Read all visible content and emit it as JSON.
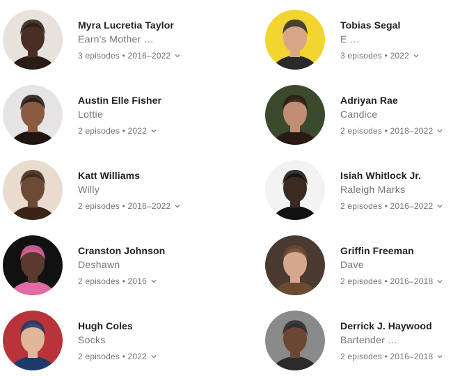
{
  "cast": [
    {
      "name": "Myra Lucretia Taylor",
      "role": "Earn's Mother …",
      "meta": "3 episodes • 2016–2022",
      "avatar_bg": "#e8e2dc",
      "avatar_fg": "#4a2d24",
      "avatar_accent": "#2b1b16"
    },
    {
      "name": "Tobias Segal",
      "role": "E …",
      "meta": "3 episodes • 2022",
      "avatar_bg": "#f2d530",
      "avatar_fg": "#d9a58a",
      "avatar_accent": "#2a2a2a"
    },
    {
      "name": "Austin Elle Fisher",
      "role": "Lottie",
      "meta": "2 episodes • 2022",
      "avatar_bg": "#e6e4e4",
      "avatar_fg": "#8a5a42",
      "avatar_accent": "#1f1511"
    },
    {
      "name": "Adriyan Rae",
      "role": "Candice",
      "meta": "2 episodes • 2018–2022",
      "avatar_bg": "#3b4a2c",
      "avatar_fg": "#c08e75",
      "avatar_accent": "#2a1a14"
    },
    {
      "name": "Katt Williams",
      "role": "Willy",
      "meta": "2 episodes • 2018–2022",
      "avatar_bg": "#e9dccf",
      "avatar_fg": "#6b4a36",
      "avatar_accent": "#3a2418"
    },
    {
      "name": "Isiah Whitlock Jr.",
      "role": "Raleigh Marks",
      "meta": "2 episodes • 2016–2022",
      "avatar_bg": "#f3f3f3",
      "avatar_fg": "#3a2a22",
      "avatar_accent": "#111111"
    },
    {
      "name": "Cranston Johnson",
      "role": "Deshawn",
      "meta": "2 episodes • 2016",
      "avatar_bg": "#111111",
      "avatar_fg": "#5a3a2c",
      "avatar_accent": "#e26aa6"
    },
    {
      "name": "Griffin Freeman",
      "role": "Dave",
      "meta": "2 episodes • 2016–2018",
      "avatar_bg": "#4a3a30",
      "avatar_fg": "#d6a88e",
      "avatar_accent": "#6b4a32"
    },
    {
      "name": "Hugh Coles",
      "role": "Socks",
      "meta": "2 episodes • 2022",
      "avatar_bg": "#b8343a",
      "avatar_fg": "#e0b79a",
      "avatar_accent": "#1e3a6a"
    },
    {
      "name": "Derrick J. Haywood",
      "role": "Bartender …",
      "meta": "2 episodes • 2016–2018",
      "avatar_bg": "#8a8a8a",
      "avatar_fg": "#6a4634",
      "avatar_accent": "#2a2a2a"
    }
  ]
}
